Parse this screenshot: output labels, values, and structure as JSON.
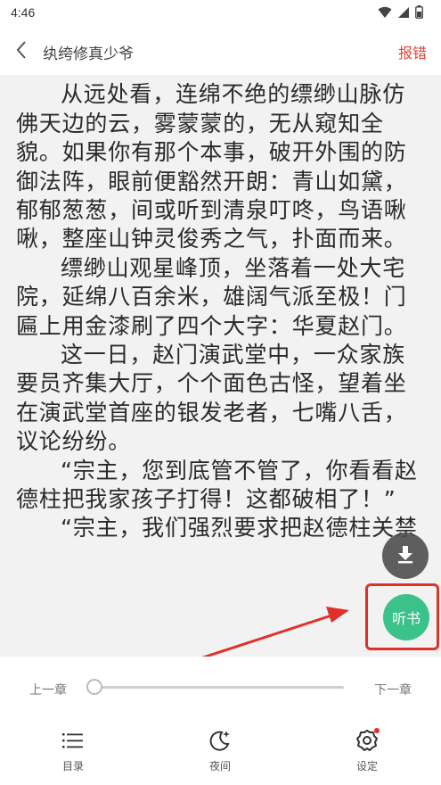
{
  "status_bar": {
    "time": "4:46"
  },
  "header": {
    "title": "纨绔修真少爷",
    "report_label": "报错"
  },
  "reader": {
    "paragraphs": [
      "从远处看，连绵不绝的缥缈山脉仿佛天边的云，雾蒙蒙的，无从窥知全貌。如果你有那个本事，破开外围的防御法阵，眼前便豁然开朗：青山如黛，郁郁葱葱，间或听到清泉叮咚，鸟语啾啾，整座山钟灵俊秀之气，扑面而来。",
      "缥缈山观星峰顶，坐落着一处大宅院，延绵八百余米，雄阔气派至极！门匾上用金漆刷了四个大字：华夏赵门。",
      "这一日，赵门演武堂中，一众家族要员齐集大厅，个个面色古怪，望着坐在演武堂首座的银发老者，七嘴八舌，议论纷纷。",
      "“宗主，您到底管不管了，你看看赵德柱把我家孩子打得！这都破相了！”",
      "“宗主，我们强烈要求把赵德柱关禁"
    ]
  },
  "floating": {
    "listen_label": "听书"
  },
  "chapter_bar": {
    "prev_label": "上一章",
    "next_label": "下一章",
    "progress": 0.0
  },
  "bottom_nav": {
    "toc_label": "目录",
    "night_label": "夜间",
    "settings_label": "设定"
  },
  "colors": {
    "accent_red": "#e0443b",
    "listen_green": "#3bc28b",
    "reader_bg": "#f2f2f2"
  },
  "icons": [
    "back-icon",
    "download-icon",
    "toc-icon",
    "night-mode-icon",
    "settings-icon",
    "wifi-icon",
    "signal-icon",
    "battery-icon"
  ]
}
